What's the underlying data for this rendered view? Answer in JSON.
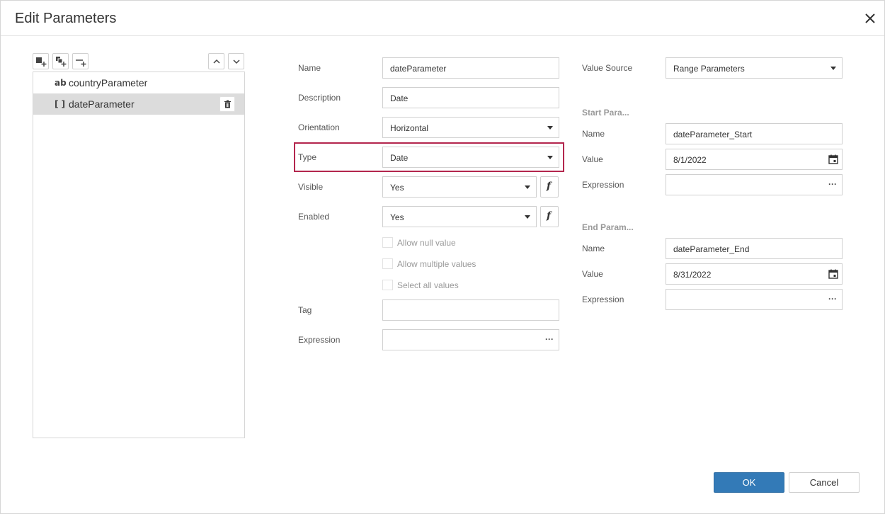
{
  "dialog": {
    "title": "Edit Parameters"
  },
  "toolbar": {
    "add_icon": "add-parameter-icon",
    "add_group_icon": "add-group-icon",
    "add_separator_icon": "add-separator-icon",
    "up_icon": "chevron-up-icon",
    "down_icon": "chevron-down-icon"
  },
  "parameters": [
    {
      "icon_text": "ab",
      "label": "countryParameter",
      "selected": false
    },
    {
      "icon_text": "[ ]",
      "label": "dateParameter",
      "selected": true
    }
  ],
  "form": {
    "name": {
      "label": "Name",
      "value": "dateParameter"
    },
    "description": {
      "label": "Description",
      "value": "Date"
    },
    "orientation": {
      "label": "Orientation",
      "value": "Horizontal"
    },
    "type": {
      "label": "Type",
      "value": "Date"
    },
    "visible": {
      "label": "Visible",
      "value": "Yes",
      "fx": "f"
    },
    "enabled": {
      "label": "Enabled",
      "value": "Yes",
      "fx": "f"
    },
    "allow_null": "Allow null value",
    "allow_multiple": "Allow multiple values",
    "select_all": "Select all values",
    "tag": {
      "label": "Tag",
      "value": ""
    },
    "expression": {
      "label": "Expression",
      "value": "",
      "dots": "···"
    }
  },
  "range": {
    "value_source": {
      "label": "Value Source",
      "value": "Range Parameters"
    },
    "start": {
      "section": "Start Para...",
      "name_label": "Name",
      "name": "dateParameter_Start",
      "value_label": "Value",
      "value": "8/1/2022",
      "expression_label": "Expression",
      "expression": "",
      "dots": "···"
    },
    "end": {
      "section": "End Param...",
      "name_label": "Name",
      "name": "dateParameter_End",
      "value_label": "Value",
      "value": "8/31/2022",
      "expression_label": "Expression",
      "expression": "",
      "dots": "···"
    }
  },
  "buttons": {
    "ok": "OK",
    "cancel": "Cancel"
  },
  "colors": {
    "accent": "#337ab7",
    "highlight": "#b3264d",
    "selected_row": "#dcdcdc"
  }
}
